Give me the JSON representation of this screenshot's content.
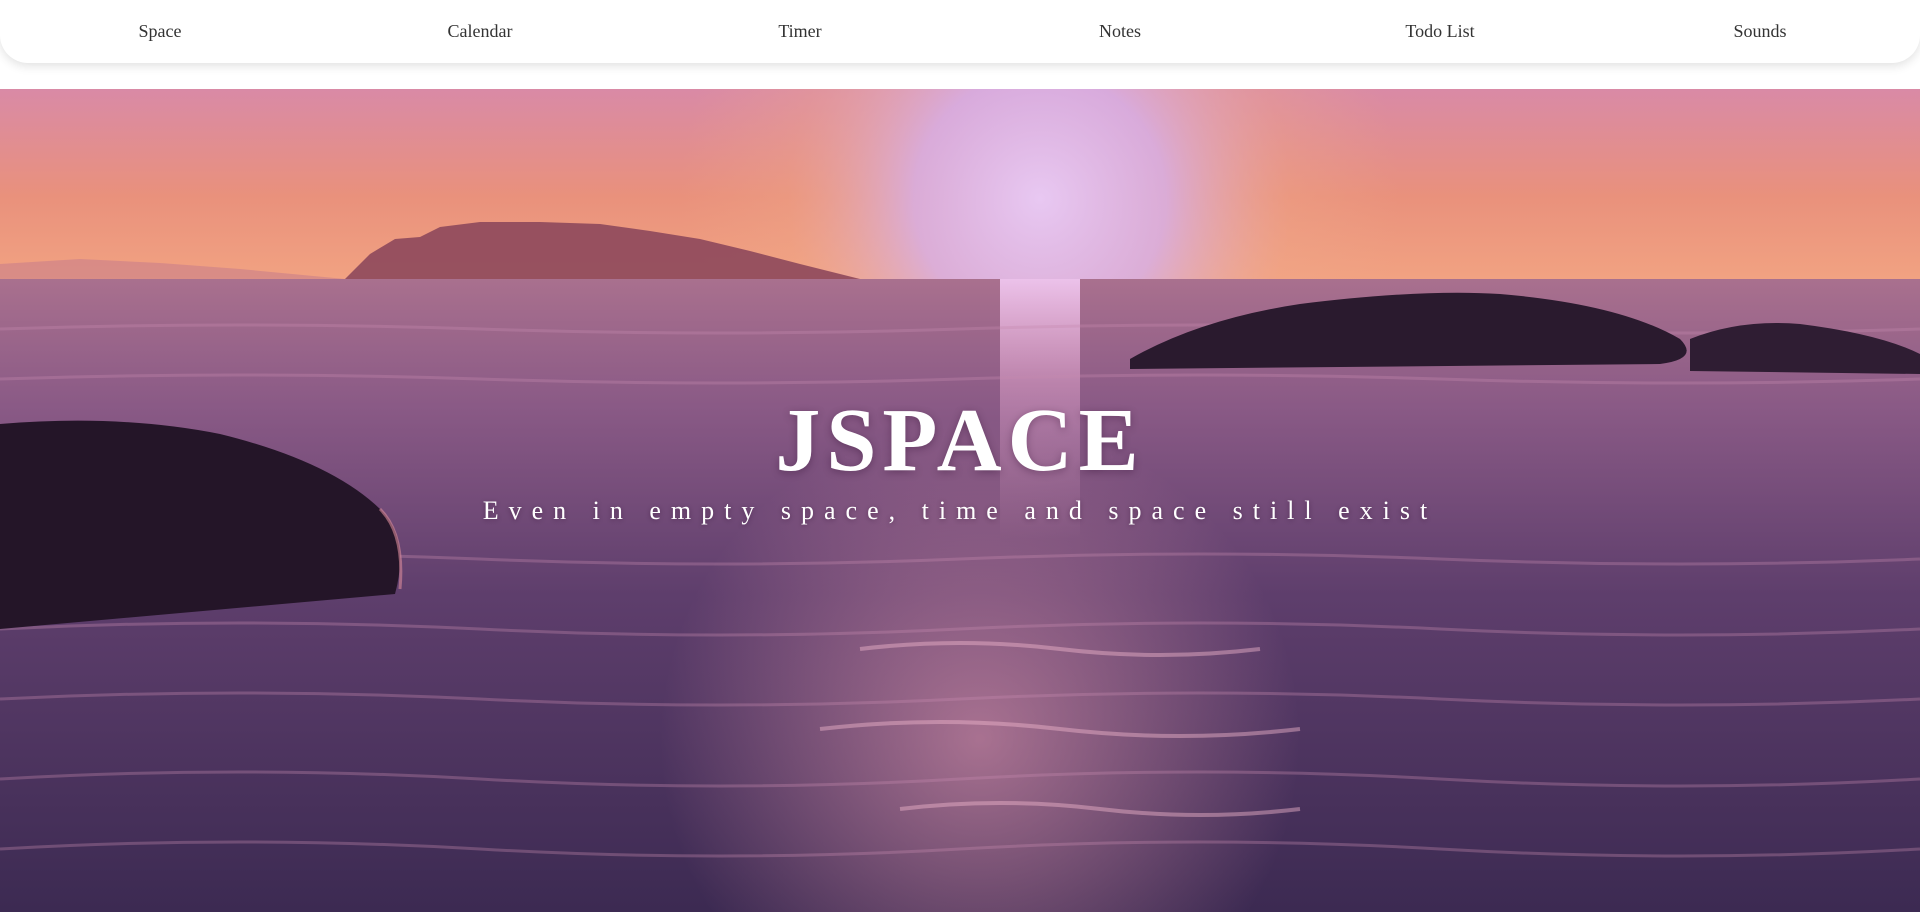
{
  "nav": {
    "items": [
      {
        "label": "Space"
      },
      {
        "label": "Calendar"
      },
      {
        "label": "Timer"
      },
      {
        "label": "Notes"
      },
      {
        "label": "Todo List"
      },
      {
        "label": "Sounds"
      }
    ]
  },
  "hero": {
    "title": "JSPACE",
    "subtitle": "Even in empty space, time and space still exist",
    "background": "sunset-over-ocean-video"
  },
  "colors": {
    "nav_bg": "#ffffff",
    "nav_text": "#333333",
    "hero_text": "#ffffff"
  }
}
